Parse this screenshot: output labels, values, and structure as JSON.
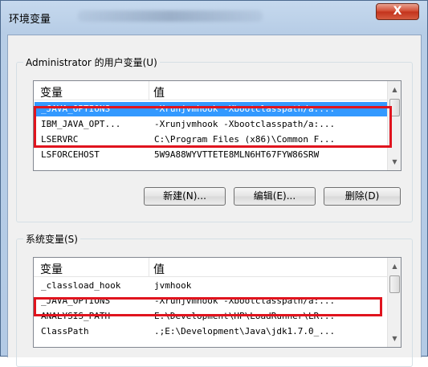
{
  "window": {
    "title": "环境变量",
    "close_glyph": "X"
  },
  "user_vars": {
    "label": "Administrator 的用户变量(U)",
    "columns": [
      "变量",
      "值"
    ],
    "rows": [
      {
        "name": "_JAVA_OPTIONS",
        "value": "-Xrunjvmhook -Xbootclasspath/a:...",
        "selected": true
      },
      {
        "name": "IBM_JAVA_OPT...",
        "value": "-Xrunjvmhook -Xbootclasspath/a:...",
        "selected": false
      },
      {
        "name": "LSERVRC",
        "value": "C:\\Program Files (x86)\\Common F...",
        "selected": false
      },
      {
        "name": "LSFORCEHOST",
        "value": "5W9A88WYVTTETE8MLN6HT67FYW86SRW",
        "selected": false
      }
    ],
    "buttons": {
      "new": "新建(N)...",
      "edit": "编辑(E)...",
      "delete": "删除(D)"
    }
  },
  "system_vars": {
    "label": "系统变量(S)",
    "columns": [
      "变量",
      "值"
    ],
    "rows": [
      {
        "name": "_classload_hook",
        "value": "jvmhook",
        "selected": false
      },
      {
        "name": "_JAVA_OPTIONS",
        "value": "-Xrunjvmhook -Xbootclasspath/a:...",
        "selected": false
      },
      {
        "name": "ANALYSIS_PATH",
        "value": "E:\\Development\\HP\\LoadRunner\\LR...",
        "selected": false
      },
      {
        "name": "ClassPath",
        "value": ".;E:\\Development\\Java\\jdk1.7.0_...",
        "selected": false
      }
    ]
  },
  "colors": {
    "highlight": "#e0141e",
    "selection": "#3399ff"
  }
}
